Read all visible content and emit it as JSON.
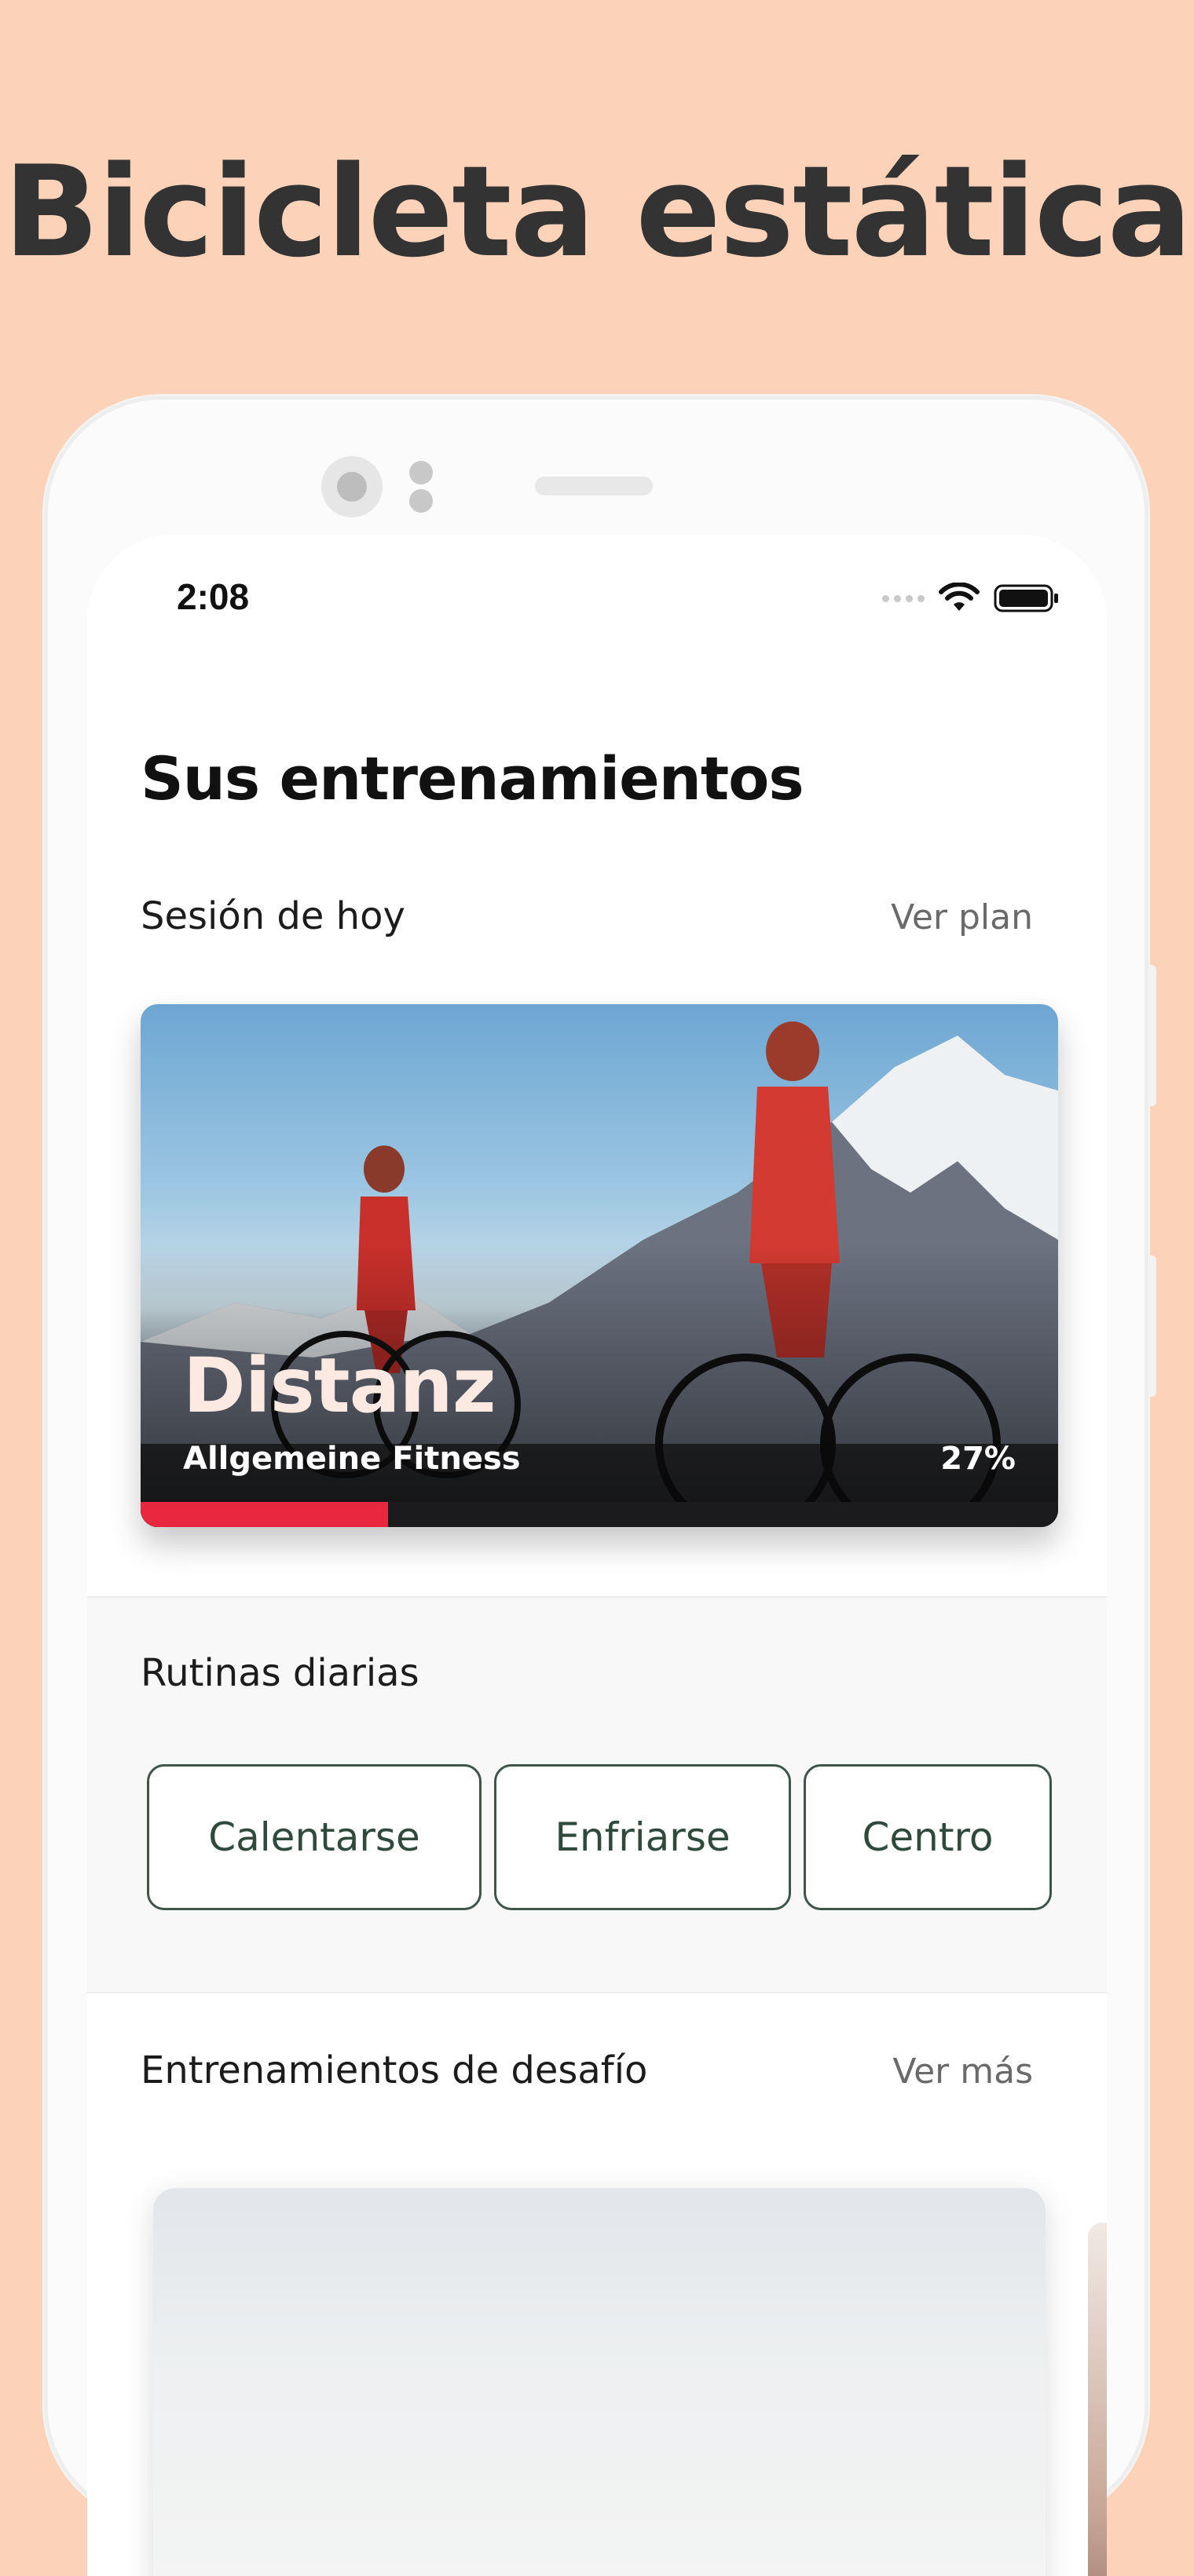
{
  "promo": {
    "title": "Bicicleta estática",
    "background": "#fcd3b9"
  },
  "status_bar": {
    "time": "2:08",
    "icons": [
      "signal-dots-icon",
      "wifi-icon",
      "battery-icon"
    ]
  },
  "screen": {
    "title": "Sus entrenamientos"
  },
  "today_session": {
    "label": "Sesión de hoy",
    "link": "Ver plan",
    "card": {
      "title": "Distanz",
      "subtitle": "Allgemeine Fitness",
      "progress_text": "27%",
      "progress": 0.27,
      "progress_color": "#e8283e"
    }
  },
  "daily_routines": {
    "label": "Rutinas diarias",
    "buttons": [
      "Calentarse",
      "Enfriarse",
      "Centro"
    ],
    "button_color": "#3e564a"
  },
  "challenges": {
    "label": "Entrenamientos de desafío",
    "link": "Ver más"
  }
}
